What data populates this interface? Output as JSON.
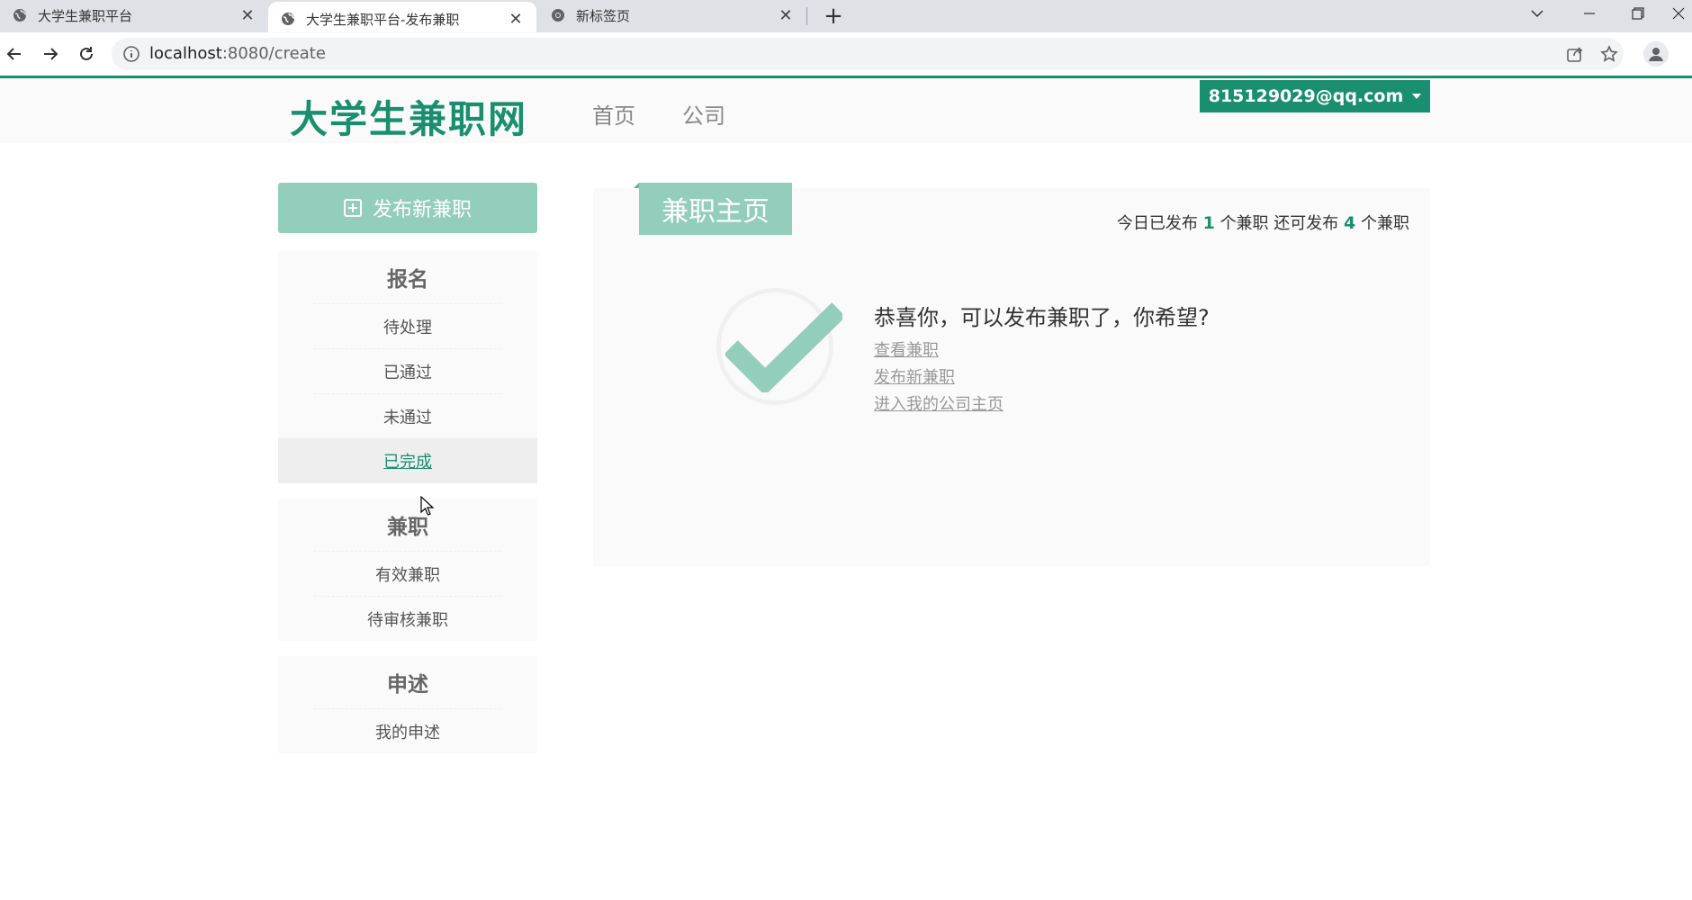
{
  "browser": {
    "tabs": [
      {
        "title": "大学生兼职平台",
        "icon": "globe-icon"
      },
      {
        "title": "大学生兼职平台-发布兼职",
        "icon": "globe-icon"
      },
      {
        "title": "新标签页",
        "icon": "chrome-icon"
      }
    ],
    "url_host": "localhost",
    "url_rest": ":8080/create"
  },
  "header": {
    "logo": "大学生兼职网",
    "nav": [
      "首页",
      "公司"
    ],
    "user_email": "815129029@qq.com"
  },
  "sidebar": {
    "publish_label": "发布新兼职",
    "groups": [
      {
        "title": "报名",
        "items": [
          "待处理",
          "已通过",
          "未通过",
          "已完成"
        ]
      },
      {
        "title": "兼职",
        "items": [
          "有效兼职",
          "待审核兼职"
        ]
      },
      {
        "title": "申述",
        "items": [
          "我的申述"
        ]
      }
    ]
  },
  "main": {
    "tab_label": "兼职主页",
    "quota": {
      "prefix": "今日已发布",
      "published": "1",
      "mid": "个兼职 还可发布",
      "remaining": "4",
      "suffix": "个兼职"
    },
    "message": "恭喜你，可以发布兼职了，你希望?",
    "links": [
      "查看兼职",
      "发布新兼职",
      "进入我的公司主页"
    ]
  },
  "colors": {
    "accent": "#1a8f6f",
    "accent_light": "#93cebd"
  }
}
